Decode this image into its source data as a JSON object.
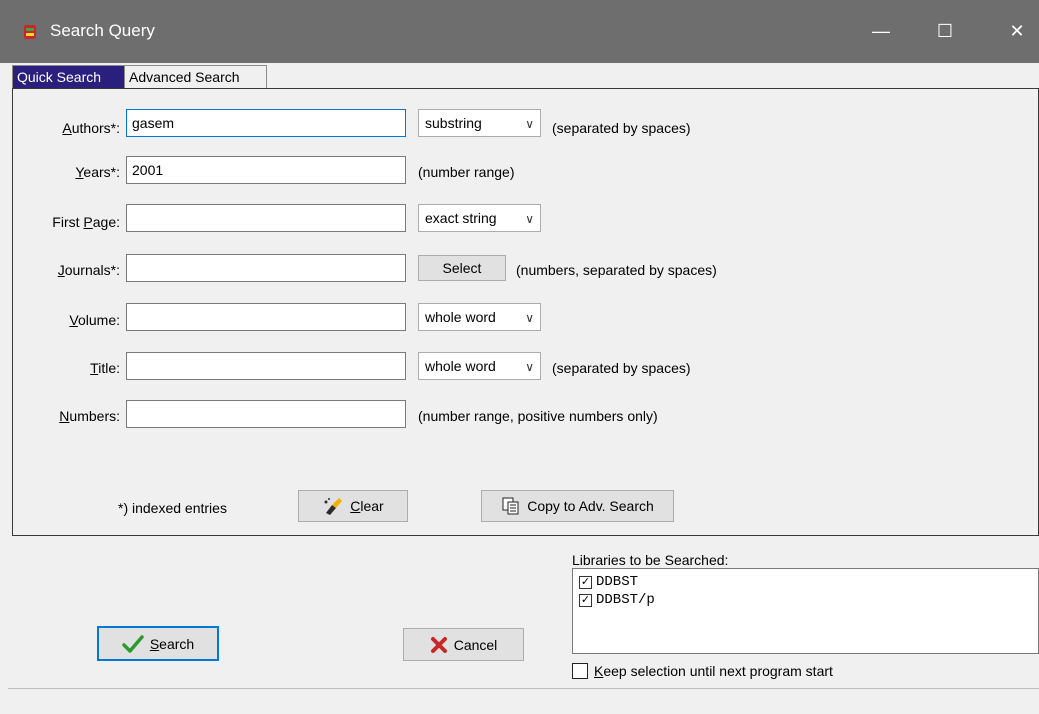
{
  "window": {
    "title": "Search Query",
    "minimize_glyph": "—",
    "maximize_glyph": "☐",
    "close_glyph": "✕"
  },
  "tabs": [
    {
      "label": "Quick Search",
      "active": true
    },
    {
      "label": "Advanced Search",
      "active": false
    }
  ],
  "form": {
    "authors": {
      "label_u": "A",
      "label_rest": "uthors*:",
      "value": "gasem",
      "mode": "substring",
      "hint": "(separated by spaces)"
    },
    "years": {
      "label_u": "Y",
      "label_rest": "ears*:",
      "value": "2001",
      "hint": "(number range)"
    },
    "first_page": {
      "label_pre": "First ",
      "label_u": "P",
      "label_rest": "age:",
      "value": "",
      "mode": "exact string"
    },
    "journals": {
      "label_u": "J",
      "label_rest": "ournals*:",
      "value": "",
      "select_label": "Select",
      "hint": "(numbers, separated by spaces)"
    },
    "volume": {
      "label_u": "V",
      "label_rest": "olume:",
      "value": "",
      "mode": "whole word"
    },
    "title": {
      "label_u": "T",
      "label_rest": "itle:",
      "value": "",
      "mode": "whole word",
      "hint": "(separated by spaces)"
    },
    "numbers": {
      "label_u": "N",
      "label_rest": "umbers:",
      "value": "",
      "hint": "(number range, positive numbers only)"
    }
  },
  "indexed_note": "*) indexed entries",
  "clear_button": {
    "label_u": "C",
    "label_rest": "lear"
  },
  "copy_button": {
    "label": "Copy to Adv. Search"
  },
  "libraries": {
    "title": "Libraries to be Searched:",
    "items": [
      {
        "label": "DDBST",
        "checked": true
      },
      {
        "label": "DDBST/p",
        "checked": true
      }
    ]
  },
  "keep_selection": {
    "label_u": "K",
    "label_rest": "eep selection until next program start",
    "checked": false
  },
  "search_button": {
    "label_u": "S",
    "label_rest": "earch"
  },
  "cancel_button": {
    "label": "Cancel"
  },
  "colors": {
    "titlebar": "#6e6e6e",
    "active_tab": "#2a1f7c",
    "focus": "#0078d7"
  }
}
